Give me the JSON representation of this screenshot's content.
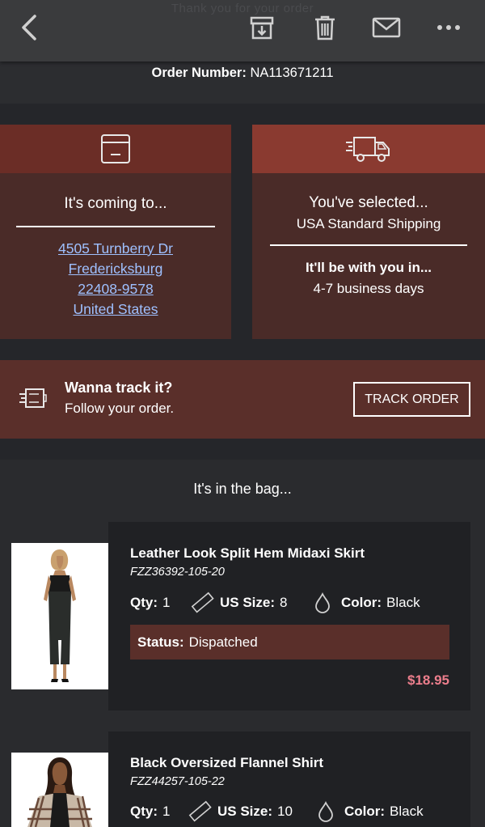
{
  "toolbar": {
    "ghost_text": "Thank you for your order",
    "back_icon": "chevron-left-icon",
    "archive_icon": "archive-icon",
    "trash_icon": "trash-icon",
    "mail_icon": "mail-icon",
    "more_icon": "more-icon"
  },
  "order": {
    "label": "Order Number:",
    "number": "NA113671211"
  },
  "delivery": {
    "icon": "box-icon",
    "title": "It's coming to...",
    "address": [
      "4505 Turnberry Dr",
      "Fredericksburg",
      "22408-9578",
      "United States"
    ]
  },
  "shipping": {
    "icon": "truck-icon",
    "title": "You've selected...",
    "method": "USA Standard Shipping",
    "eta_label": "It'll be with you in...",
    "eta": "4-7 business days"
  },
  "track": {
    "icon": "tracking-icon",
    "title": "Wanna track it?",
    "subtitle": "Follow your order.",
    "button": "TRACK ORDER"
  },
  "bag": {
    "title": "It's in the bag..."
  },
  "items": [
    {
      "name": "Leather Look Split Hem Midaxi Skirt",
      "sku": "FZZ36392-105-20",
      "qty_label": "Qty:",
      "qty": "1",
      "size_label": "US Size:",
      "size": "8",
      "color_label": "Color:",
      "color": "Black",
      "status_label": "Status:",
      "status": "Dispatched",
      "price": "$18.95"
    },
    {
      "name": "Black Oversized Flannel Shirt",
      "sku": "FZZ44257-105-22",
      "qty_label": "Qty:",
      "qty": "1",
      "size_label": "US Size:",
      "size": "10",
      "color_label": "Color:",
      "color": "Black"
    }
  ],
  "colors": {
    "card_head": "#6b2d26",
    "card_body": "#4a2b28",
    "link": "#9ec0ff",
    "price": "#ec7e8c"
  }
}
